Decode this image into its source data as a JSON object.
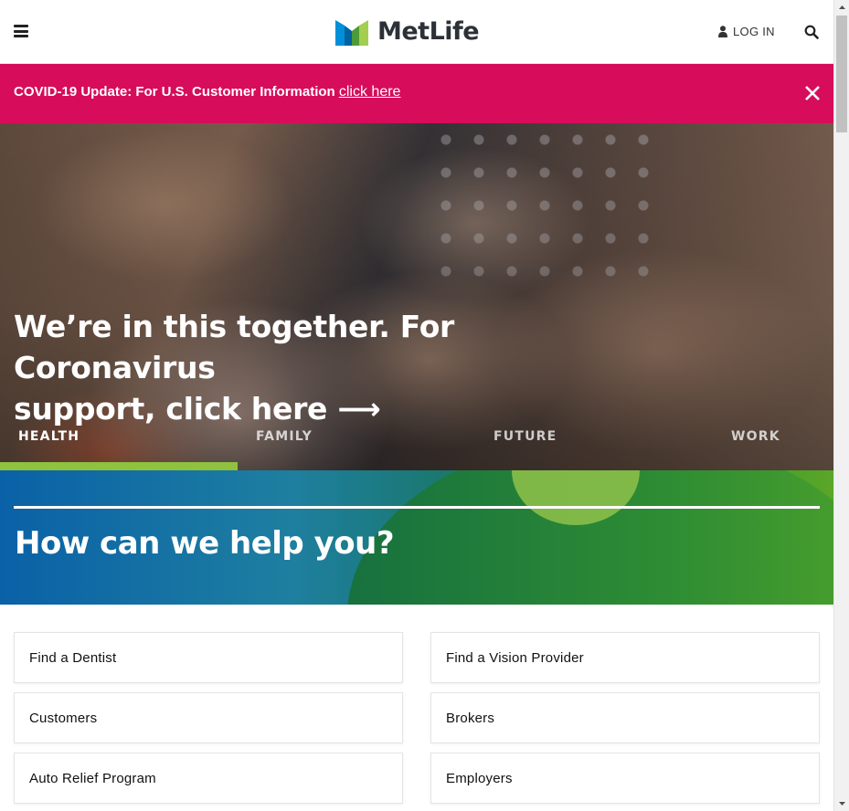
{
  "header": {
    "brand": "MetLife",
    "login_label": "LOG IN",
    "icons": [
      "hamburger-menu-icon",
      "metlife-logo-mark",
      "user-icon",
      "search-icon"
    ]
  },
  "alert": {
    "text": "COVID-19 Update: For U.S. Customer Information",
    "link_label": "click here",
    "background": "#d70c5b"
  },
  "hero": {
    "title_line1": "We’re in this together. For Coronavirus",
    "title_line2": "support, click here ⟶",
    "tabs": [
      {
        "label": "HEALTH",
        "active": true
      },
      {
        "label": "FAMILY",
        "active": false
      },
      {
        "label": "FUTURE",
        "active": false
      },
      {
        "label": "WORK",
        "active": false
      }
    ],
    "active_tab_color": "#8fc23f"
  },
  "help": {
    "title": "How can we help you?"
  },
  "links": [
    {
      "label": "Find a Dentist"
    },
    {
      "label": "Find a Vision Provider"
    },
    {
      "label": "Customers"
    },
    {
      "label": "Brokers"
    },
    {
      "label": "Auto Relief Program"
    },
    {
      "label": "Employers"
    }
  ]
}
